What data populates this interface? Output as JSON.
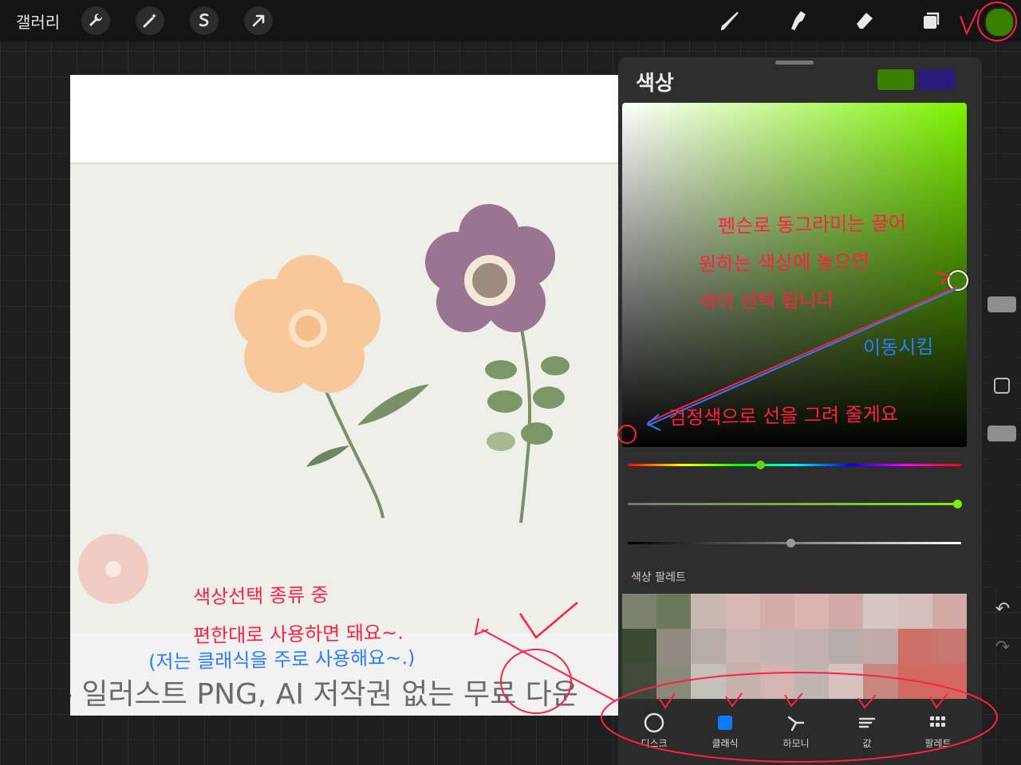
{
  "topbar": {
    "gallery_label": "갤러리",
    "tools_left": [
      "wrench-icon",
      "magic-wand-icon",
      "selection-icon",
      "transform-arrow-icon"
    ],
    "tools_right": [
      "brush-icon",
      "smudge-icon",
      "eraser-icon",
      "layers-icon"
    ],
    "current_color": "#3a8000"
  },
  "canvas": {
    "caption_text": "- 일러스트 PNG, AI 저작권 없는 무료 다운"
  },
  "color_panel": {
    "title": "색상",
    "primary_swatch": "#3a8000",
    "secondary_swatch": "#2a1a7a",
    "picker_hue_color": "#7cf200",
    "palette_label": "색상 팔레트",
    "palette_rows": [
      [
        "#7a816f",
        "#6a7a5a",
        "#c8b8b0",
        "#d8b8b4",
        "#d4aca8",
        "#d9b4b0",
        "#d2a9a8",
        "#d8c6c0",
        "#d4c0bc",
        "#d4aaa8"
      ],
      [
        "#3a4a35",
        "#908a80",
        "#b8aca6",
        "#c8b4b0",
        "#c4b4b2",
        "#c2b2b0",
        "#b8aca8",
        "#c2aaa8",
        "#cc7068",
        "#c87670"
      ],
      [
        "#404a3a",
        "#8a8878",
        "#c6c0ba",
        "#c8b0ac",
        "#d4b4b0",
        "#c2b4b2",
        "#d6c2be",
        "#c88880",
        "#d06a60",
        "#d26860"
      ]
    ],
    "tabs": [
      {
        "label": "디스크",
        "icon": "disc-icon"
      },
      {
        "label": "클래식",
        "icon": "classic-square-icon"
      },
      {
        "label": "하모니",
        "icon": "harmony-icon"
      },
      {
        "label": "값",
        "icon": "value-sliders-icon"
      },
      {
        "label": "팔레트",
        "icon": "palette-grid-icon"
      }
    ],
    "active_tab": "클래식",
    "accent": "#0a7cff"
  },
  "sidebar": {
    "undo_icon": "undo-icon",
    "redo_icon": "redo-icon"
  },
  "annotations": {
    "picker_line1": "펜슨로 동그라미는 끌어",
    "picker_line2": "원하는 색상에 놓으면",
    "picker_line3": "색이 선택 됩니다",
    "move_note": "이동시킴",
    "black_note": "검정색으로 선을 그려 줄게요",
    "canvas_line1": "색상선택 종류 중",
    "canvas_line2": "편한대로 사용하면 돼요~.",
    "canvas_line3": "(저는 클래식을 주로 사용해요~.)",
    "red_color": "#ff2040",
    "blue_color": "#2a7cff"
  }
}
